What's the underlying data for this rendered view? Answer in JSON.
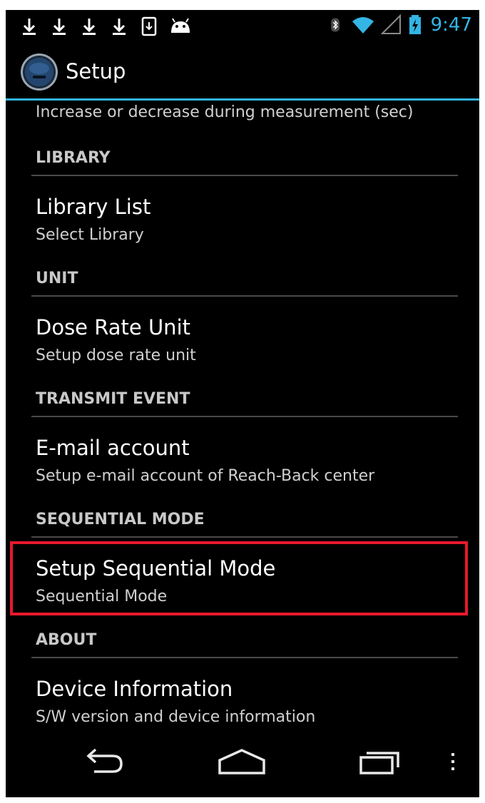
{
  "status_bar": {
    "left_icons": [
      "download-icon",
      "download-icon",
      "download-icon",
      "download-icon",
      "sd-card-icon",
      "android-icon"
    ],
    "right_icons": [
      "bluetooth-icon",
      "wifi-icon",
      "signal-icon",
      "battery-charging-icon"
    ],
    "time": "9:47",
    "accent_color": "#33b5e5"
  },
  "action_bar": {
    "title": "Setup",
    "app_icon": "app-logo-icon"
  },
  "settings": {
    "top_summary": "Increase or decrease during measurement (sec)",
    "categories": [
      {
        "header": "LIBRARY",
        "title": "Library List",
        "summary": "Select Library"
      },
      {
        "header": "UNIT",
        "title": "Dose Rate Unit",
        "summary": "Setup dose rate unit"
      },
      {
        "header": "TRANSMIT EVENT",
        "title": "E-mail account",
        "summary": "Setup e-mail account of Reach-Back center"
      },
      {
        "header": "SEQUENTIAL MODE",
        "title": "Setup Sequential Mode",
        "summary": "Sequential Mode"
      },
      {
        "header": "ABOUT",
        "title": "Device Information",
        "summary": "S/W version and device information"
      }
    ],
    "highlight_color": "#e8192c"
  },
  "nav_bar": {
    "buttons": [
      "back-icon",
      "home-icon",
      "recent-apps-icon",
      "overflow-menu-icon"
    ]
  }
}
